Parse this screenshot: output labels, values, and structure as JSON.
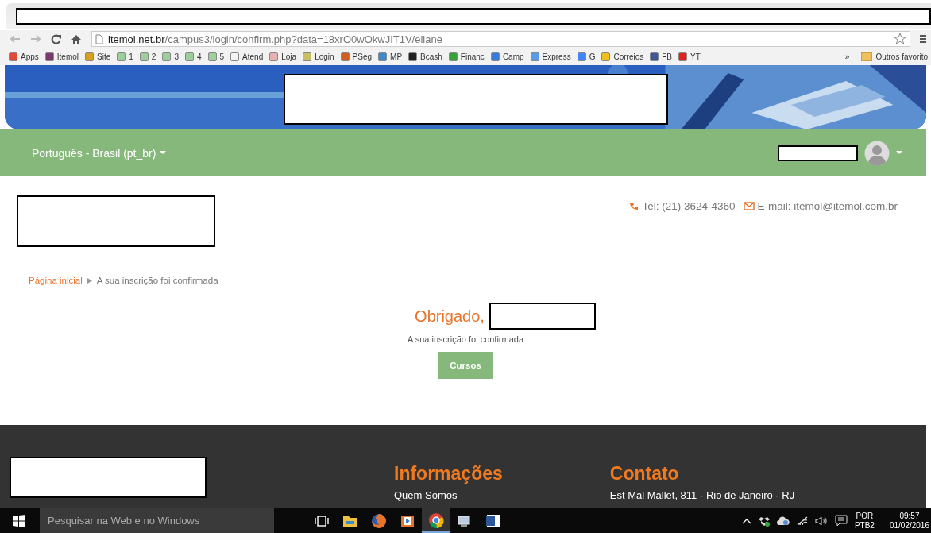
{
  "browser": {
    "url_host": "itemol.net.br",
    "url_path": "/campus3/login/confirm.php?data=18xrO0wOkwJIT1V/eliane",
    "bookmarks": [
      {
        "label": "Apps",
        "color": "#e04a3a"
      },
      {
        "label": "Itemol",
        "color": "#7a3a6a"
      },
      {
        "label": "Site",
        "color": "#d9a020"
      },
      {
        "label": "1",
        "color": "#9ccf9c"
      },
      {
        "label": "2",
        "color": "#9ccf9c"
      },
      {
        "label": "3",
        "color": "#9ccf9c"
      },
      {
        "label": "4",
        "color": "#9ccf9c"
      },
      {
        "label": "5",
        "color": "#9ccf9c"
      },
      {
        "label": "Atend",
        "color": "#f4f4f4"
      },
      {
        "label": "Loja",
        "color": "#e8b0b0"
      },
      {
        "label": "Login",
        "color": "#c8c060"
      },
      {
        "label": "PSeg",
        "color": "#d06020"
      },
      {
        "label": "MP",
        "color": "#3a8ad0"
      },
      {
        "label": "Bcash",
        "color": "#202020"
      },
      {
        "label": "Financ",
        "color": "#3aa03a"
      },
      {
        "label": "Camp",
        "color": "#3a7ad8"
      },
      {
        "label": "Express",
        "color": "#5a9ae8"
      },
      {
        "label": "G",
        "color": "#4285f4"
      },
      {
        "label": "Correios",
        "color": "#f0c020"
      },
      {
        "label": "FB",
        "color": "#3b5998"
      },
      {
        "label": "YT",
        "color": "#e62117"
      }
    ],
    "more": "»",
    "other": "Outros favorito"
  },
  "nav": {
    "language": "Português - Brasil (pt_br)"
  },
  "contact": {
    "phone": "Tel: (21) 3624-4360",
    "email": "E-mail: itemol@itemol.com.br"
  },
  "breadcrumb": [
    {
      "label": "Página inicial",
      "link": true
    },
    {
      "label": "A sua inscrição foi confirmada",
      "link": false
    }
  ],
  "main": {
    "greeting": "Obrigado,",
    "message": "A sua inscrição foi confirmada",
    "button": "Cursos"
  },
  "footer": {
    "columns": [
      {
        "title": "Informações",
        "items": [
          "Quem Somos"
        ]
      },
      {
        "title": "Contato",
        "items": [
          "Est Mal Mallet, 811 - Rio de Janeiro - RJ"
        ]
      }
    ]
  },
  "taskbar": {
    "search_placeholder": "Pesquisar na Web e no Windows",
    "apps": [
      {
        "kind": "taskview",
        "selected": false
      },
      {
        "kind": "explorer",
        "selected": false
      },
      {
        "kind": "firefox",
        "selected": false
      },
      {
        "kind": "media",
        "selected": false
      },
      {
        "kind": "chrome",
        "selected": true
      },
      {
        "kind": "network",
        "selected": false
      },
      {
        "kind": "word",
        "selected": false
      }
    ],
    "language": "POR",
    "layout": "PTB2",
    "time": "09:57",
    "date": "01/02/2016"
  }
}
